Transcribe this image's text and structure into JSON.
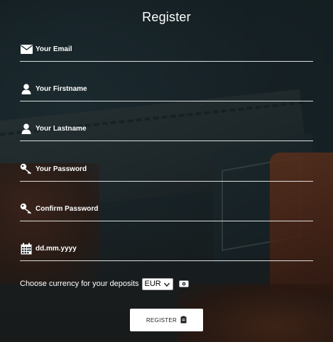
{
  "form": {
    "title": "Register",
    "fields": [
      {
        "placeholder": "Your Email",
        "icon": "envelope-icon"
      },
      {
        "placeholder": "Your Firstname",
        "icon": "user-icon"
      },
      {
        "placeholder": "Your Lastname",
        "icon": "user-icon"
      },
      {
        "placeholder": "Your Password",
        "icon": "key-icon"
      },
      {
        "placeholder": "Confirm Password",
        "icon": "key-icon"
      },
      {
        "placeholder": "dd.mm.yyyy",
        "icon": "calendar-icon"
      }
    ],
    "currency": {
      "label": "Choose currency for your deposits",
      "selected": "EUR",
      "icon": "money-icon"
    },
    "submit_label": "REGISTER",
    "submit_icon": "clipboard-icon"
  },
  "colors": {
    "text": "#ffffff",
    "button_bg": "#ffffff",
    "button_text": "#222222"
  }
}
